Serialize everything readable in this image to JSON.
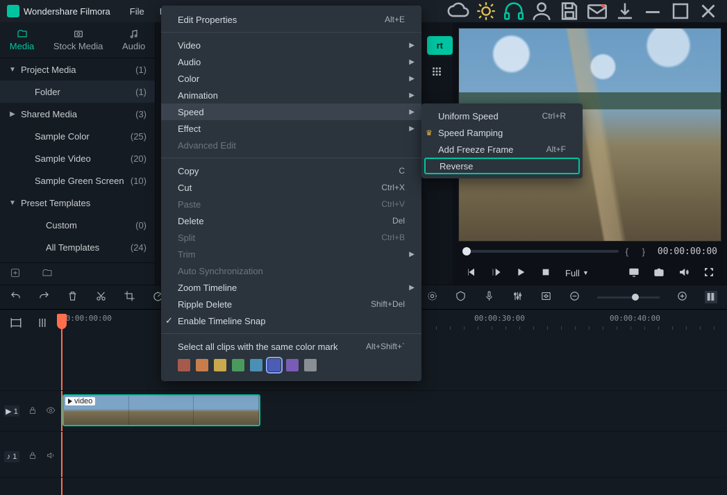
{
  "app": {
    "title": "Wondershare Filmora"
  },
  "topmenu": {
    "file": "File",
    "edit": "Edit"
  },
  "tabs": {
    "media": "Media",
    "stock": "Stock Media",
    "audio": "Audio"
  },
  "sidebar": {
    "items": [
      {
        "label": "Project Media",
        "count": "(1)",
        "level": 0,
        "caret": "▼"
      },
      {
        "label": "Folder",
        "count": "(1)",
        "level": 1,
        "caret": "",
        "selected": true
      },
      {
        "label": "Shared Media",
        "count": "(3)",
        "level": 0,
        "caret": "▶"
      },
      {
        "label": "Sample Color",
        "count": "(25)",
        "level": 1,
        "caret": ""
      },
      {
        "label": "Sample Video",
        "count": "(20)",
        "level": 1,
        "caret": ""
      },
      {
        "label": "Sample Green Screen",
        "count": "(10)",
        "level": 1,
        "caret": ""
      },
      {
        "label": "Preset Templates",
        "count": "",
        "level": 0,
        "caret": "▼"
      },
      {
        "label": "Custom",
        "count": "(0)",
        "level": 2,
        "caret": ""
      },
      {
        "label": "All Templates",
        "count": "(24)",
        "level": 2,
        "caret": ""
      }
    ]
  },
  "export": {
    "label": "rt"
  },
  "preview": {
    "timecode": "00:00:00:00",
    "braces": "{    }",
    "full": "Full"
  },
  "timeline": {
    "ruler": {
      "t0": "00:00:00:00",
      "t1": "00:00:30:00",
      "t2": "00:00:40:00"
    },
    "track1": "▶ 1",
    "track2": "♪ 1",
    "clipLabel": "video"
  },
  "contextmenu": {
    "edit_properties": "Edit Properties",
    "edit_properties_k": "Alt+E",
    "video": "Video",
    "audio": "Audio",
    "color": "Color",
    "animation": "Animation",
    "speed": "Speed",
    "effect": "Effect",
    "advanced_edit": "Advanced Edit",
    "copy": "Copy",
    "copy_k": "C",
    "cut": "Cut",
    "cut_k": "Ctrl+X",
    "paste": "Paste",
    "paste_k": "Ctrl+V",
    "delete": "Delete",
    "delete_k": "Del",
    "split": "Split",
    "split_k": "Ctrl+B",
    "trim": "Trim",
    "autosync": "Auto Synchronization",
    "zoomtl": "Zoom Timeline",
    "ripple": "Ripple Delete",
    "ripple_k": "Shift+Del",
    "snap": "Enable Timeline Snap",
    "selectall": "Select all clips with the same color mark",
    "selectall_k": "Alt+Shift+`",
    "colors": [
      "#a65a4c",
      "#c87d4b",
      "#c9a94b",
      "#4b9a5d",
      "#4b8fb5",
      "#4b5db5",
      "#7a5bb5",
      "#8a8f96"
    ],
    "selectedColor": 5
  },
  "submenu": {
    "uniform": "Uniform Speed",
    "uniform_k": "Ctrl+R",
    "ramping": "Speed Ramping",
    "freeze": "Add Freeze Frame",
    "freeze_k": "Alt+F",
    "reverse": "Reverse"
  }
}
